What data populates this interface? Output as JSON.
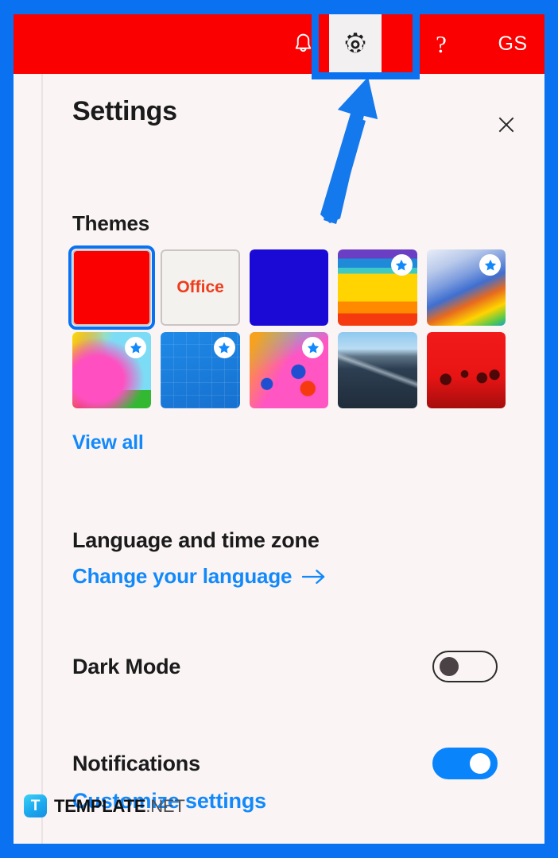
{
  "appbar": {
    "bell_icon": "bell-icon",
    "gear_icon": "gear-icon",
    "help_label": "?",
    "avatar_initials": "GS",
    "background_color": "#fa0000",
    "gear_button_background": "#f2f0f0"
  },
  "panel": {
    "title": "Settings",
    "close_icon": "close-icon",
    "background_color": "#faf4f5"
  },
  "themes": {
    "heading": "Themes",
    "view_all_label": "View all",
    "selected_index": 0,
    "tiles": [
      {
        "name": "red-theme",
        "label": "",
        "premium": false,
        "selected": true,
        "color": "#fa0000",
        "style": "solid"
      },
      {
        "name": "office-theme",
        "label": "Office",
        "premium": false,
        "selected": false,
        "color": "#f4f2ee",
        "style": "office"
      },
      {
        "name": "blue-theme",
        "label": "",
        "premium": false,
        "selected": false,
        "color": "#1b09d6",
        "style": "solid"
      },
      {
        "name": "sunset-stripes-theme",
        "label": "",
        "premium": true,
        "selected": false,
        "color": "#ffd400",
        "style": "stripes"
      },
      {
        "name": "swirl-theme",
        "label": "",
        "premium": true,
        "selected": false,
        "color": "#cfd9ef",
        "style": "swirl"
      },
      {
        "name": "unicorn-theme",
        "label": "",
        "premium": true,
        "selected": false,
        "color": "#ff4fc0",
        "style": "unicorn"
      },
      {
        "name": "school-blueprint-theme",
        "label": "",
        "premium": true,
        "selected": false,
        "color": "#1a7ee0",
        "style": "blueprint"
      },
      {
        "name": "building-blocks-theme",
        "label": "",
        "premium": true,
        "selected": false,
        "color": "#ff56c4",
        "style": "blocks"
      },
      {
        "name": "mountain-theme",
        "label": "",
        "premium": false,
        "selected": false,
        "color": "#2d3f52",
        "style": "mountain"
      },
      {
        "name": "red-palms-theme",
        "label": "",
        "premium": false,
        "selected": false,
        "color": "#e81414",
        "style": "palms"
      }
    ],
    "star_badge_icon": "star-icon"
  },
  "language": {
    "heading": "Language and time zone",
    "link_label": "Change your language",
    "arrow_icon": "arrow-right-icon"
  },
  "dark_mode": {
    "heading": "Dark Mode",
    "enabled": false,
    "state_label": "off"
  },
  "notifications": {
    "heading": "Notifications",
    "enabled": true,
    "state_label": "on",
    "customize_label": "Customize settings"
  },
  "annotation": {
    "highlight_target": "gear-icon",
    "highlight_color": "#0a72f0",
    "arrow_icon": "arrow-up-icon"
  },
  "watermark": {
    "logo_letter": "T",
    "brand": "TEMPLATE",
    "suffix": ".NET"
  }
}
